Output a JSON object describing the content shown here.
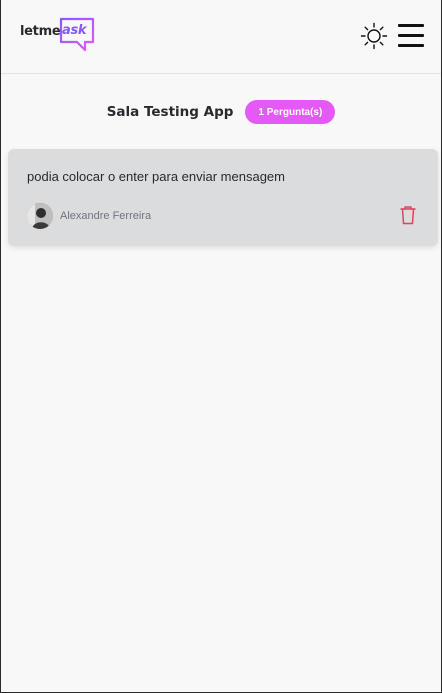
{
  "header": {
    "logo_part1": "letme",
    "logo_part2": "ask",
    "theme_icon": "sun-icon",
    "menu_icon": "hamburger-menu-icon"
  },
  "room": {
    "title": "Sala Testing App",
    "badge": "1 Pergunta(s)"
  },
  "questions": [
    {
      "content": "podia colocar o enter para enviar mensagem",
      "author": "Alexandre Ferreira",
      "delete_icon": "trash-icon"
    }
  ],
  "colors": {
    "accent": "#835afd",
    "badge": "#e559f9",
    "danger": "#e73f5d",
    "card": "#dbdcdd",
    "background": "#f8f8f8"
  }
}
